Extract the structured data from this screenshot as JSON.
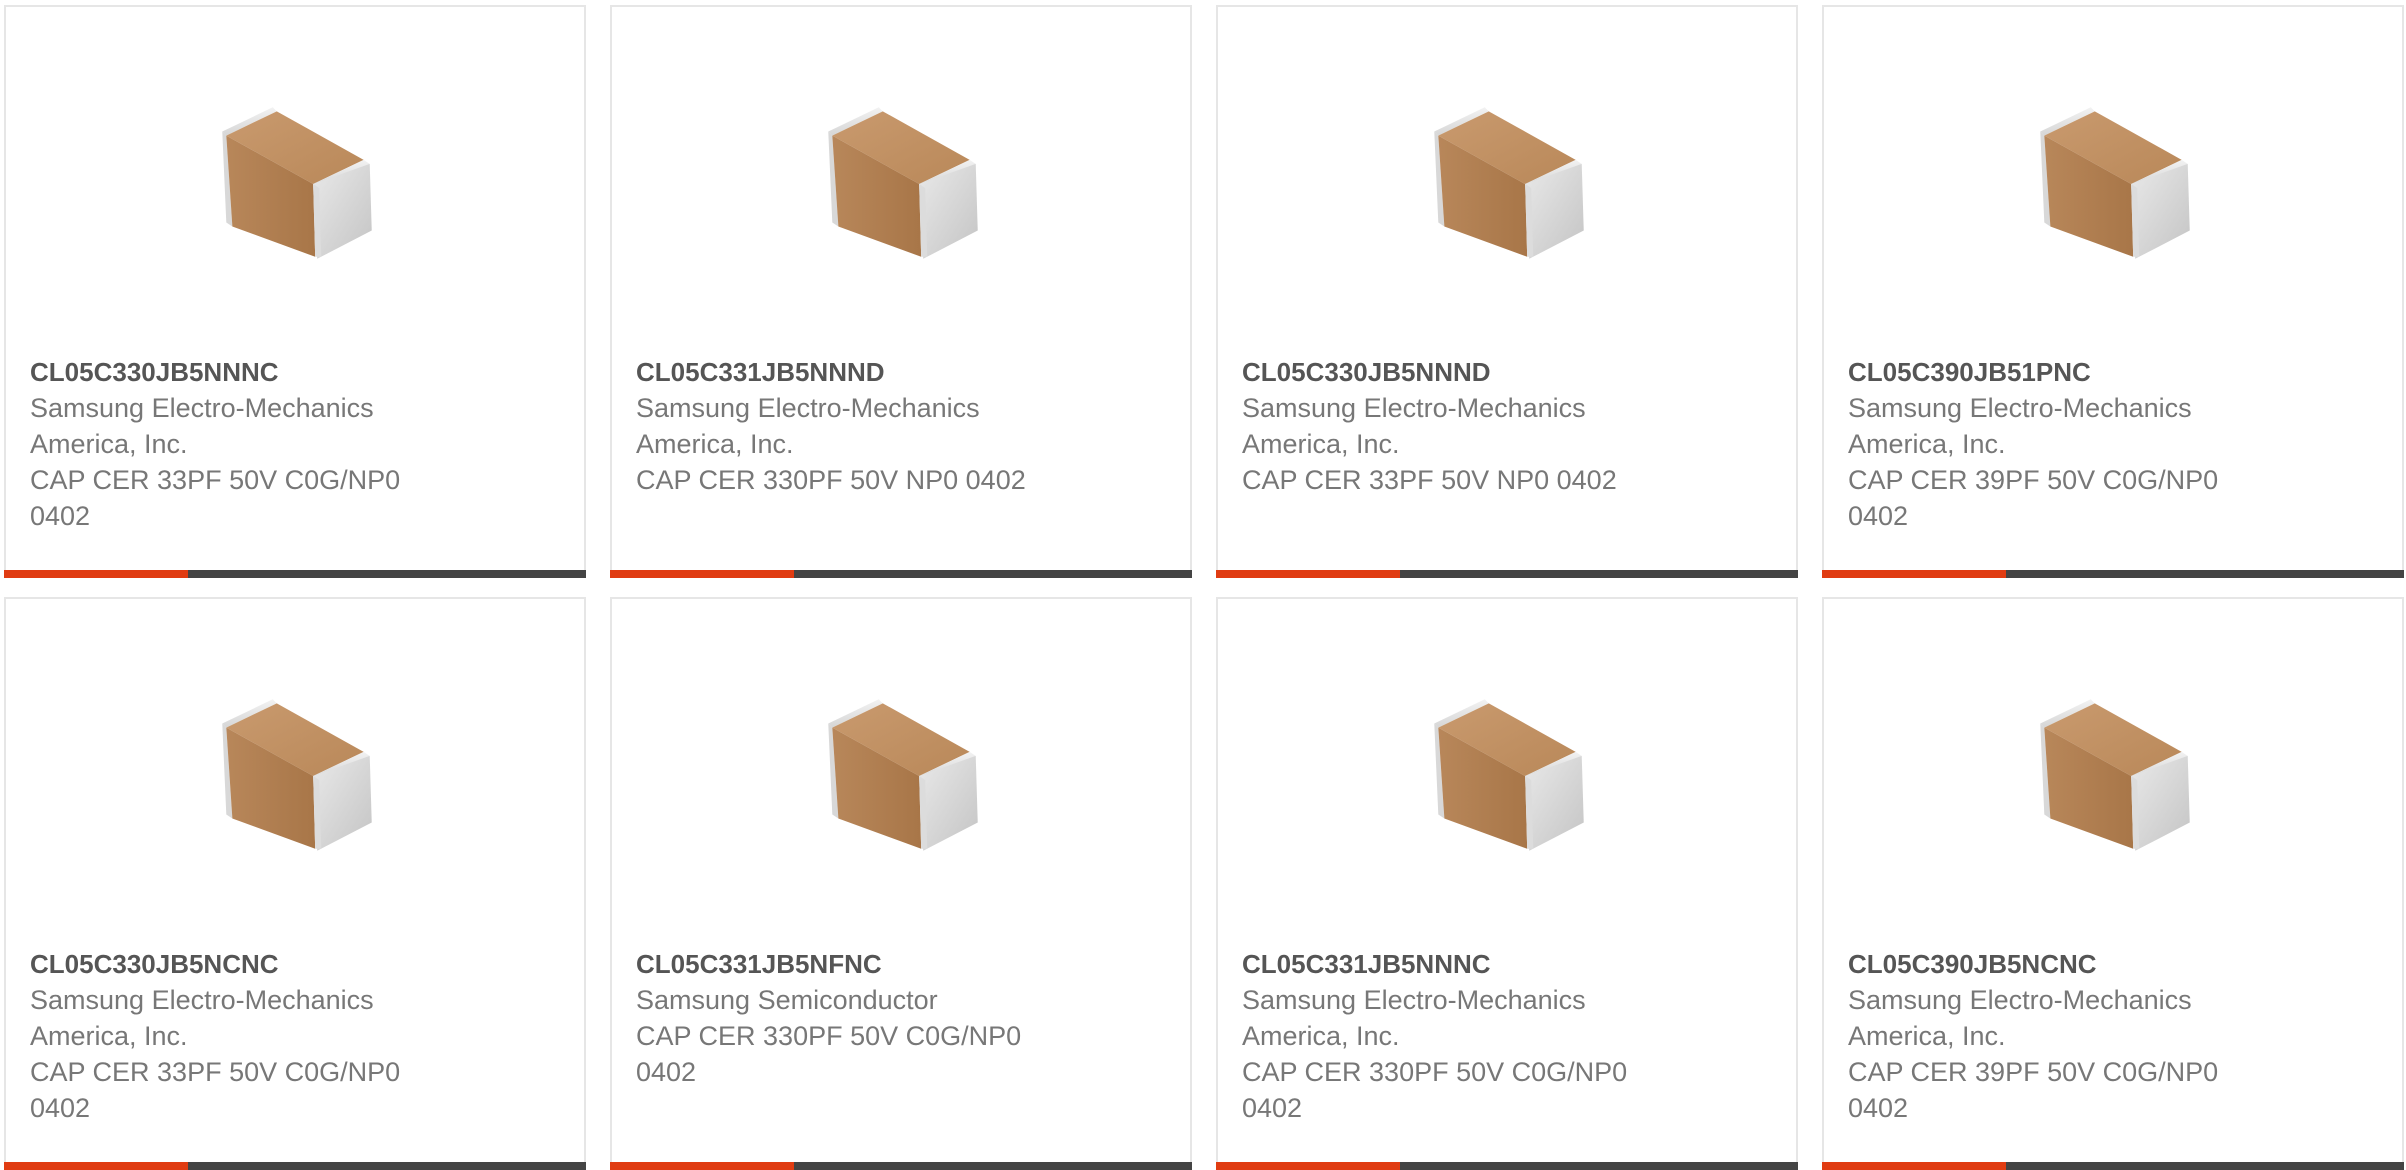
{
  "colors": {
    "accent": "#e03c12",
    "bar": "#444444",
    "border": "#e6e6e6"
  },
  "products": [
    {
      "part": "CL05C330JB5NNNC",
      "maker": [
        "Samsung Electro-Mechanics",
        "America, Inc."
      ],
      "desc": [
        "CAP CER 33PF 50V C0G/NP0",
        "0402"
      ],
      "image": "ceramic-capacitor-0402"
    },
    {
      "part": "CL05C331JB5NNND",
      "maker": [
        "Samsung Electro-Mechanics",
        "America, Inc."
      ],
      "desc": [
        "CAP CER 330PF 50V NP0 0402"
      ],
      "image": "ceramic-capacitor-0402"
    },
    {
      "part": "CL05C330JB5NNND",
      "maker": [
        "Samsung Electro-Mechanics",
        "America, Inc."
      ],
      "desc": [
        "CAP CER 33PF 50V NP0 0402"
      ],
      "image": "ceramic-capacitor-0402"
    },
    {
      "part": "CL05C390JB51PNC",
      "maker": [
        "Samsung Electro-Mechanics",
        "America, Inc."
      ],
      "desc": [
        "CAP CER 39PF 50V C0G/NP0",
        "0402"
      ],
      "image": "ceramic-capacitor-0402"
    },
    {
      "part": "CL05C330JB5NCNC",
      "maker": [
        "Samsung Electro-Mechanics",
        "America, Inc."
      ],
      "desc": [
        "CAP CER 33PF 50V C0G/NP0",
        "0402"
      ],
      "image": "ceramic-capacitor-0402"
    },
    {
      "part": "CL05C331JB5NFNC",
      "maker": [
        "Samsung Semiconductor"
      ],
      "desc": [
        "CAP CER 330PF 50V C0G/NP0",
        "0402"
      ],
      "image": "ceramic-capacitor-0402"
    },
    {
      "part": "CL05C331JB5NNNC",
      "maker": [
        "Samsung Electro-Mechanics",
        "America, Inc."
      ],
      "desc": [
        "CAP CER 330PF 50V C0G/NP0",
        "0402"
      ],
      "image": "ceramic-capacitor-0402"
    },
    {
      "part": "CL05C390JB5NCNC",
      "maker": [
        "Samsung Electro-Mechanics",
        "America, Inc."
      ],
      "desc": [
        "CAP CER 39PF 50V C0G/NP0",
        "0402"
      ],
      "image": "ceramic-capacitor-0402"
    }
  ]
}
